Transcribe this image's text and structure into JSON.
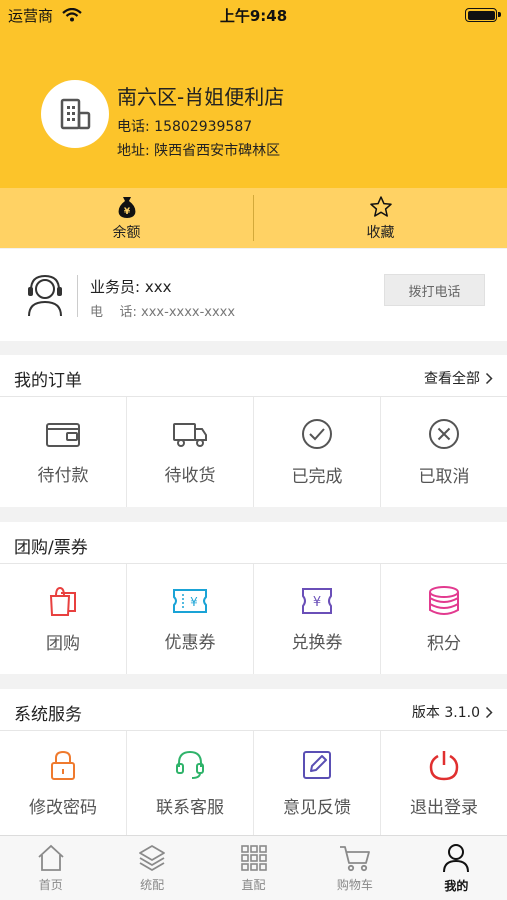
{
  "status_bar": {
    "carrier": "运营商",
    "time": "上午9:48"
  },
  "store": {
    "name": "南六区-肖姐便利店",
    "phone": "电话: 15802939587",
    "address": "地址: 陕西省西安市碑林区"
  },
  "quick_actions": [
    {
      "label": "余额",
      "icon": "money-bag-icon"
    },
    {
      "label": "收藏",
      "icon": "star-icon"
    }
  ],
  "salesperson": {
    "name": "业务员: xxx",
    "phone": "电    话: xxx-xxxx-xxxx",
    "call_label": "拨打电话"
  },
  "orders": {
    "title": "我的订单",
    "view_all": "查看全部",
    "items": [
      {
        "label": "待付款",
        "icon": "wallet-icon"
      },
      {
        "label": "待收货",
        "icon": "truck-icon"
      },
      {
        "label": "已完成",
        "icon": "check-circle-icon"
      },
      {
        "label": "已取消",
        "icon": "cancel-circle-icon"
      }
    ]
  },
  "coupons": {
    "title": "团购/票券",
    "items": [
      {
        "label": "团购",
        "icon": "shopping-bag-icon",
        "color": "#e8403f"
      },
      {
        "label": "优惠券",
        "icon": "coupon-icon",
        "color": "#1aa3d6"
      },
      {
        "label": "兑换券",
        "icon": "exchange-coupon-icon",
        "color": "#6a4fb8"
      },
      {
        "label": "积分",
        "icon": "coins-stack-icon",
        "color": "#e23a8f"
      }
    ]
  },
  "services": {
    "title": "系统服务",
    "version": "版本 3.1.0",
    "items": [
      {
        "label": "修改密码",
        "icon": "lock-icon",
        "color": "#ef7a2e"
      },
      {
        "label": "联系客服",
        "icon": "headset-icon",
        "color": "#2fb36a"
      },
      {
        "label": "意见反馈",
        "icon": "edit-icon",
        "color": "#5a4fb4"
      },
      {
        "label": "退出登录",
        "icon": "power-icon",
        "color": "#e02f2f"
      }
    ]
  },
  "tabs": [
    {
      "label": "首页",
      "icon": "home-icon"
    },
    {
      "label": "统配",
      "icon": "layers-icon"
    },
    {
      "label": "直配",
      "icon": "grid-icon"
    },
    {
      "label": "购物车",
      "icon": "cart-icon"
    },
    {
      "label": "我的",
      "icon": "user-icon",
      "active": true
    }
  ],
  "colors": {
    "header": "#fcc42a",
    "quickbar": "#ffd264"
  }
}
